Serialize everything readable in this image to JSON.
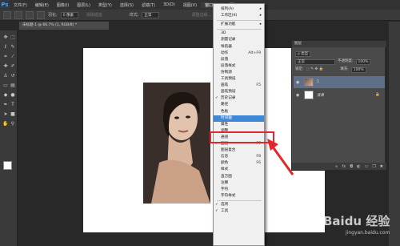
{
  "menubar": {
    "logo": "Ps",
    "items": [
      "文件(F)",
      "编辑(E)",
      "图像(I)",
      "图层(L)",
      "类型(Y)",
      "选择(S)",
      "滤镜(T)",
      "3D(D)",
      "视图(V)",
      "窗口(W)",
      "帮助(H)"
    ]
  },
  "options": {
    "feather_label": "羽化:",
    "feather_value": "0 像素",
    "antialias": "消除锯齿",
    "style_label": "样式:",
    "style_value": "正常",
    "refine": "调整边缘..."
  },
  "document": {
    "tab_title": "未标题-1 @ 66.7% (1, RGB/8) *"
  },
  "window_menu": {
    "items": [
      {
        "label": "排列(A)",
        "submenu": true
      },
      {
        "label": "工作区(K)",
        "submenu": true
      },
      {
        "sep": true
      },
      {
        "label": "扩展功能",
        "submenu": true
      },
      {
        "sep": true
      },
      {
        "label": "3D"
      },
      {
        "label": "测量记录"
      },
      {
        "label": "导航器"
      },
      {
        "label": "动作",
        "shortcut": "Alt+F9"
      },
      {
        "label": "段落"
      },
      {
        "label": "段落样式"
      },
      {
        "label": "仿制源"
      },
      {
        "label": "工具预设"
      },
      {
        "label": "画笔",
        "shortcut": "F5"
      },
      {
        "label": "画笔预设"
      },
      {
        "label": "历史记录",
        "checked": true
      },
      {
        "label": "路径"
      },
      {
        "label": "色板"
      },
      {
        "label": "时间轴",
        "highlight": true
      },
      {
        "label": "属性"
      },
      {
        "label": "调整"
      },
      {
        "label": "通道"
      },
      {
        "label": "图层",
        "shortcut": "F7",
        "checked": true
      },
      {
        "label": "图层复合"
      },
      {
        "label": "信息",
        "shortcut": "F8"
      },
      {
        "label": "颜色",
        "shortcut": "F6"
      },
      {
        "label": "样式"
      },
      {
        "label": "直方图"
      },
      {
        "label": "注释"
      },
      {
        "label": "字符"
      },
      {
        "label": "字符样式"
      },
      {
        "sep": true
      },
      {
        "label": "选项",
        "checked": true
      },
      {
        "label": "工具",
        "checked": true
      }
    ]
  },
  "layers": {
    "tab": "图层",
    "kind_label": "ρ 类型",
    "blend_mode": "正常",
    "opacity_label": "不透明度:",
    "opacity_value": "100%",
    "lock_label": "锁定:",
    "fill_label": "填充:",
    "fill_value": "100%",
    "rows": [
      {
        "name": "1",
        "selected": true
      },
      {
        "name": "背景",
        "locked": true
      }
    ]
  },
  "watermark": {
    "text": "Baidu 经验",
    "sub": "jingyan.baidu.com"
  },
  "colors": {
    "highlight": "#3f88d6",
    "redbox": "#e3262a",
    "selected_layer": "#5f6f87"
  }
}
